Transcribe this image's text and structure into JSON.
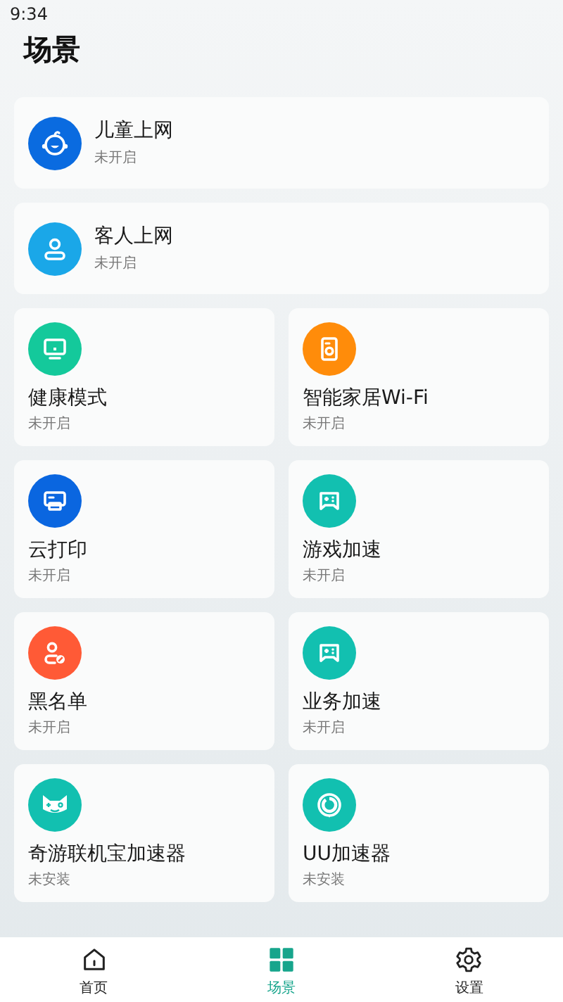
{
  "status_bar": {
    "time": "9:34"
  },
  "title": "场景",
  "wide_cards": [
    {
      "name": "儿童上网",
      "status": "未开启",
      "color": "#0a6be0"
    },
    {
      "name": "客人上网",
      "status": "未开启",
      "color": "#1aa7e8"
    }
  ],
  "grid_cards": [
    {
      "name": "健康模式",
      "status": "未开启",
      "color": "#14c99b"
    },
    {
      "name": "智能家居Wi-Fi",
      "status": "未开启",
      "color": "#ff8c0a"
    },
    {
      "name": "云打印",
      "status": "未开启",
      "color": "#0a66e0"
    },
    {
      "name": "游戏加速",
      "status": "未开启",
      "color": "#12c0b0"
    },
    {
      "name": "黑名单",
      "status": "未开启",
      "color": "#ff5a36"
    },
    {
      "name": "业务加速",
      "status": "未开启",
      "color": "#12c0b0"
    },
    {
      "name": "奇游联机宝加速器",
      "status": "未安装",
      "color": "#12c0b0"
    },
    {
      "name": "UU加速器",
      "status": "未安装",
      "color": "#12c0b0"
    }
  ],
  "nav": [
    {
      "label": "首页",
      "selected": false
    },
    {
      "label": "场景",
      "selected": true
    },
    {
      "label": "设置",
      "selected": false
    }
  ]
}
